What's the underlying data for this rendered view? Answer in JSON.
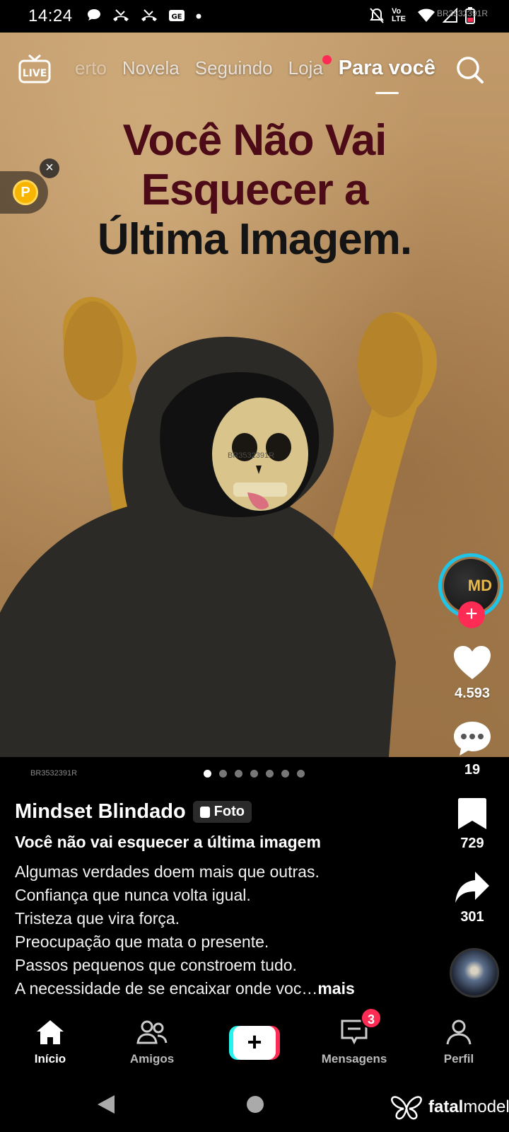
{
  "status_bar": {
    "time": "14:24",
    "network_label": "Vo LTE",
    "device_code": "BR3532391R",
    "icons": [
      "chat-bubble-icon",
      "missed-call-icon",
      "missed-call-icon",
      "news-icon",
      "dot-icon",
      "mute-icon",
      "wifi-icon",
      "signal-icon",
      "battery-icon"
    ]
  },
  "top_nav": {
    "live_label": "LIVE",
    "tabs": [
      {
        "label": "erto",
        "active": false
      },
      {
        "label": "Novela",
        "active": false
      },
      {
        "label": "Seguindo",
        "active": false
      },
      {
        "label": "Loja",
        "active": false,
        "dot": true
      },
      {
        "label": "Para você",
        "active": true
      }
    ],
    "search_icon": "search-icon"
  },
  "post": {
    "headline_line1": "Você Não Vai",
    "headline_line2": "Esquecer a",
    "headline_line3": "Última Imagem.",
    "watermark": "BR3532391R",
    "slide_count": 7,
    "active_slide": 1
  },
  "coin_widget": {
    "coin_symbol": "P",
    "close_symbol": "×"
  },
  "creator": {
    "avatar_initials": "MD",
    "follow_symbol": "+"
  },
  "actions": {
    "likes": "4.593",
    "comments": "19",
    "saves": "729",
    "shares": "301"
  },
  "caption": {
    "author": "Mindset Blindado",
    "badge": "Foto",
    "title": "Você não vai esquecer a última imagem",
    "lines": [
      "Algumas verdades doem mais que outras.",
      "Confiança que nunca volta igual.",
      "Tristeza que vira força.",
      "Preocupação que mata o presente.",
      "Passos pequenos que constroem tudo."
    ],
    "last_line": "A necessidade de se encaixar onde voc…",
    "more": "mais"
  },
  "bottom_nav": {
    "home": "Início",
    "friends": "Amigos",
    "create": "+",
    "messages": "Mensagens",
    "messages_badge": "3",
    "profile": "Perfil"
  },
  "system_nav": {
    "brand_a": "fatal",
    "brand_b": "model"
  },
  "colors": {
    "accent_red": "#fe2c55",
    "accent_cyan": "#25f4ee",
    "headline_maroon": "#4c0b17"
  }
}
